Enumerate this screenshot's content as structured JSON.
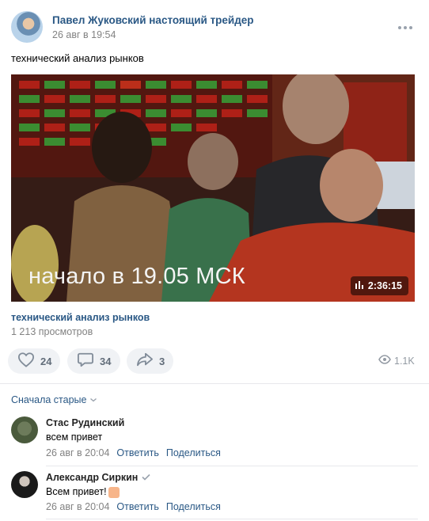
{
  "post": {
    "author": "Павел Жуковский настоящий трейдер",
    "date": "26 авг в 19:54",
    "text": "технический анализ рынков"
  },
  "video": {
    "caption": "начало в 19.05  МСК",
    "duration": "2:36:15",
    "title": "технический анализ рынков",
    "views": "1 213 просмотров"
  },
  "actions": {
    "likes": "24",
    "comments": "34",
    "shares": "3",
    "views": "1.1K"
  },
  "sort": {
    "label": "Сначала старые"
  },
  "comments": [
    {
      "author": "Стас Рудинский",
      "text": "всем привет",
      "date": "26 авг в 20:04",
      "reply": "Ответить",
      "share": "Поделиться"
    },
    {
      "author": "Александр Сиркин",
      "text": "Всем привет!",
      "date": "26 авг в 20:04",
      "reply": "Ответить",
      "share": "Поделиться"
    }
  ],
  "icons": {
    "more": "more-dots-icon",
    "like": "heart-icon",
    "comment": "comment-bubble-icon",
    "share": "share-arrow-icon",
    "views": "eye-icon",
    "duration": "video-bars-icon",
    "sort": "chevron-down-icon",
    "verified": "checkmark-icon",
    "emoji": "raised-hand-emoji-icon"
  },
  "colors": {
    "link": "#2a5885",
    "secondary": "#828282",
    "button_bg": "#f0f2f5"
  }
}
